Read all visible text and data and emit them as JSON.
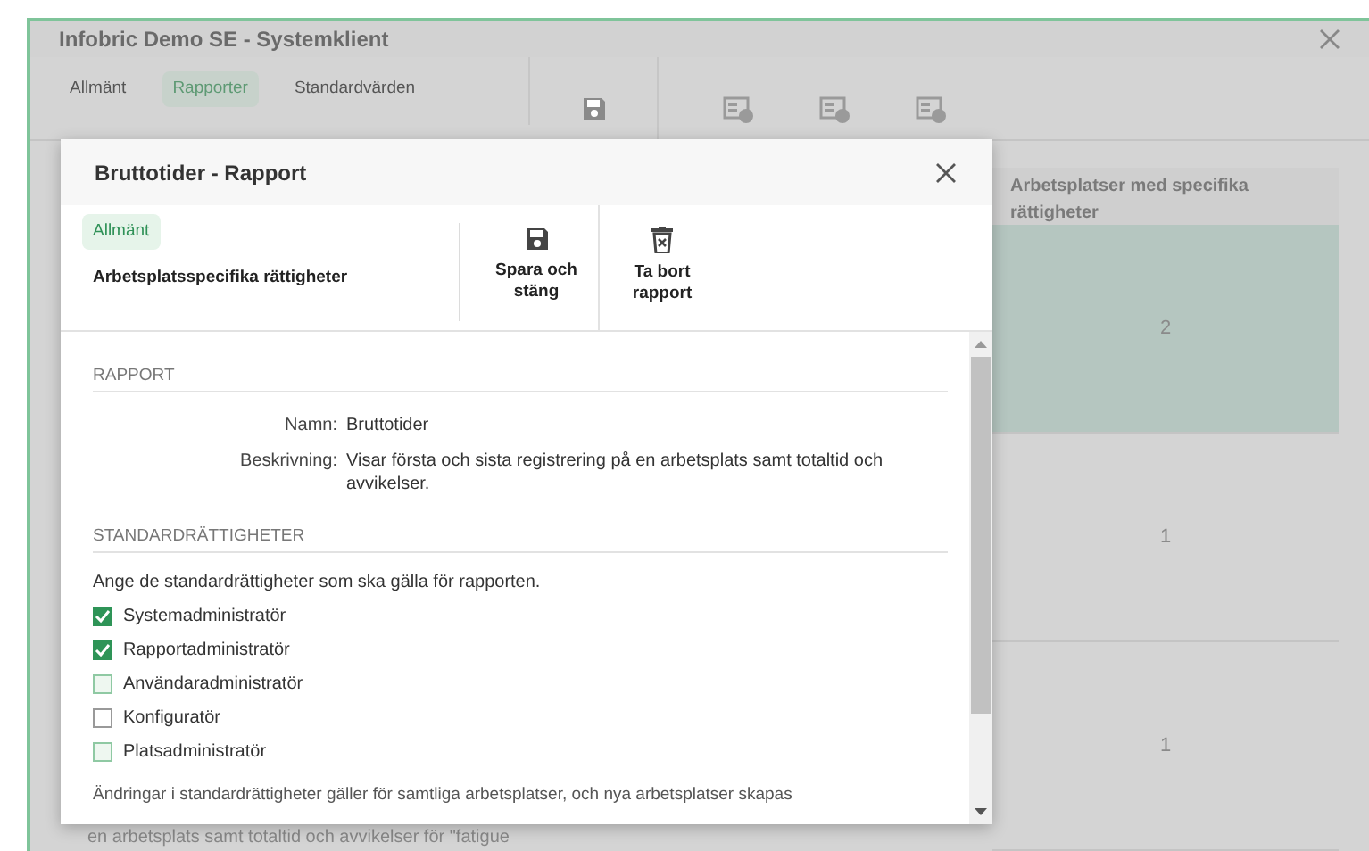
{
  "background_window": {
    "title": "Infobric Demo SE - Systemklient",
    "tabs": [
      {
        "label": "Allmänt",
        "selected": false
      },
      {
        "label": "Rapporter",
        "selected": true
      },
      {
        "label": "Standardvärden",
        "selected": false
      }
    ],
    "table": {
      "columns": [
        "Arbetsplatser med specifika rättigheter"
      ],
      "rows": [
        {
          "value": "2",
          "selected": true
        },
        {
          "value": "1",
          "selected": false
        },
        {
          "value": "1",
          "selected": false
        }
      ]
    },
    "footer_text": "en arbetsplats samt totaltid och avvikelser för \"fatigue"
  },
  "dialog": {
    "title": "Bruttotider - Rapport",
    "tabs": [
      {
        "label": "Allmänt",
        "selected": true
      },
      {
        "label": "Arbetsplatsspecifika rättigheter",
        "selected": false
      }
    ],
    "actions": [
      {
        "label": "Spara och stäng",
        "kind": "save"
      },
      {
        "label": "Ta bort rapport",
        "kind": "delete"
      }
    ],
    "report_section": {
      "heading": "RAPPORT",
      "fields": [
        {
          "label": "Namn:",
          "value": "Bruttotider"
        },
        {
          "label": "Beskrivning:",
          "value": "Visar första och sista registrering på en arbetsplats samt totaltid och avvikelser."
        }
      ]
    },
    "rights_section": {
      "heading": "STANDARDRÄTTIGHETER",
      "intro": "Ange de standardrättigheter som ska gälla för rapporten.",
      "options": [
        {
          "label": "Systemadministratör",
          "checked": true,
          "highlighted": true
        },
        {
          "label": "Rapportadministratör",
          "checked": true,
          "highlighted": true
        },
        {
          "label": "Användaradministratör",
          "checked": false,
          "highlighted": true
        },
        {
          "label": "Konfiguratör",
          "checked": false,
          "highlighted": false
        },
        {
          "label": "Platsadministratör",
          "checked": false,
          "highlighted": true
        }
      ],
      "note": "Ändringar i standardrättigheter gäller för samtliga arbetsplatser, och nya arbetsplatser skapas"
    }
  }
}
